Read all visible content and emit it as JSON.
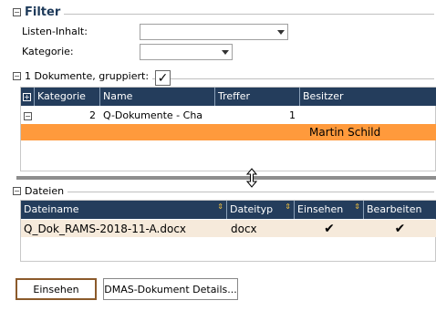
{
  "filter": {
    "title": "Filter",
    "toggle": "−",
    "listen_label": "Listen-Inhalt:",
    "listen_value": "",
    "kategorie_label": "Kategorie:",
    "kategorie_value": ""
  },
  "groups": {
    "toggle": "−",
    "title": "1 Dokumente, gruppiert:",
    "checkmark": "✓",
    "columns": {
      "expand": "+",
      "kategorie": "Kategorie",
      "name": "Name",
      "treffer": "Treffer",
      "besitzer": "Besitzer"
    },
    "row": {
      "toggle": "−",
      "kategorie": "2",
      "name": "Q-Dokumente - Cha",
      "treffer": "1",
      "besitzer": ""
    },
    "highlight_row": {
      "besitzer": "Martin Schild"
    },
    "highlight_color": "#ff9a3c",
    "header_color": "#243d5c"
  },
  "dateien": {
    "toggle": "−",
    "title": "Dateien",
    "columns": {
      "dateiname": "Dateiname",
      "dateityp": "Dateityp",
      "einsehen": "Einsehen",
      "bearbeiten": "Bearbeiten"
    },
    "sort_icon": "⇕",
    "row": {
      "dateiname": "Q_Dok_RAMS-2018-11-A.docx",
      "dateityp": "docx",
      "einsehen": "✔",
      "bearbeiten": "✔"
    },
    "row_color": "#f6eadb"
  },
  "buttons": {
    "einsehen": "Einsehen",
    "details": "DMAS-Dokument Details..."
  }
}
